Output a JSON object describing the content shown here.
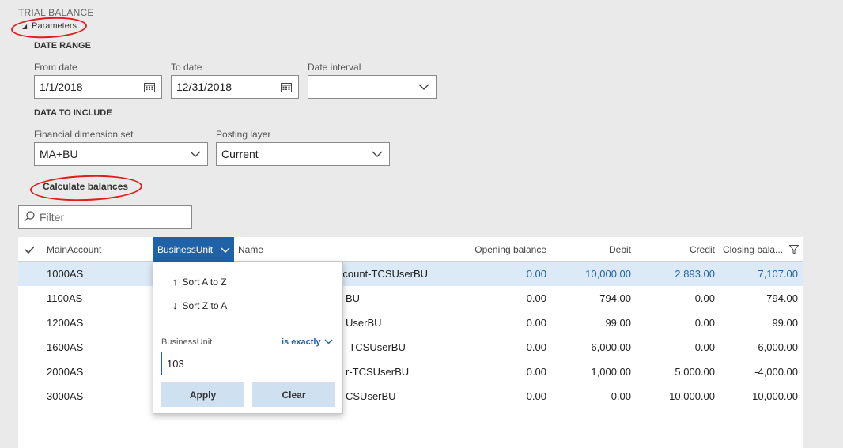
{
  "page": {
    "title": "TRIAL BALANCE",
    "params_label": "Parameters"
  },
  "date_range": {
    "heading": "DATE RANGE",
    "from_label": "From date",
    "from_value": "1/1/2018",
    "to_label": "To date",
    "to_value": "12/31/2018",
    "interval_label": "Date interval",
    "interval_value": ""
  },
  "data_include": {
    "heading": "DATA TO INCLUDE",
    "dimset_label": "Financial dimension set",
    "dimset_value": "MA+BU",
    "layer_label": "Posting layer",
    "layer_value": "Current"
  },
  "calc_button": "Calculate balances",
  "filter": {
    "placeholder": "Filter"
  },
  "grid": {
    "columns": {
      "main": "MainAccount",
      "bu": "BusinessUnit",
      "name": "Name",
      "opening": "Opening balance",
      "debit": "Debit",
      "credit": "Credit",
      "closing": "Closing bala..."
    },
    "rows": [
      {
        "main": "1000AS",
        "name": "count-TCSUserBU",
        "opening": "0.00",
        "debit": "10,000.00",
        "credit": "2,893.00",
        "closing": "7,107.00"
      },
      {
        "main": "1100AS",
        "name": "BU",
        "opening": "0.00",
        "debit": "794.00",
        "credit": "0.00",
        "closing": "794.00"
      },
      {
        "main": "1200AS",
        "name": "UserBU",
        "opening": "0.00",
        "debit": "99.00",
        "credit": "0.00",
        "closing": "99.00"
      },
      {
        "main": "1600AS",
        "name": "-TCSUserBU",
        "opening": "0.00",
        "debit": "6,000.00",
        "credit": "0.00",
        "closing": "6,000.00"
      },
      {
        "main": "2000AS",
        "name": "r-TCSUserBU",
        "opening": "0.00",
        "debit": "1,000.00",
        "credit": "5,000.00",
        "closing": "-4,000.00"
      },
      {
        "main": "3000AS",
        "name": "CSUserBU",
        "opening": "0.00",
        "debit": "0.00",
        "credit": "10,000.00",
        "closing": "-10,000.00"
      }
    ]
  },
  "popup": {
    "sort_asc": "Sort A to Z",
    "sort_desc": "Sort Z to A",
    "field_label": "BusinessUnit",
    "operator": "is exactly",
    "value": "103",
    "apply": "Apply",
    "clear": "Clear"
  },
  "colors": {
    "accent": "#1f62a8",
    "selected_row": "#dceaf7",
    "annotation": "#e21b1b"
  }
}
